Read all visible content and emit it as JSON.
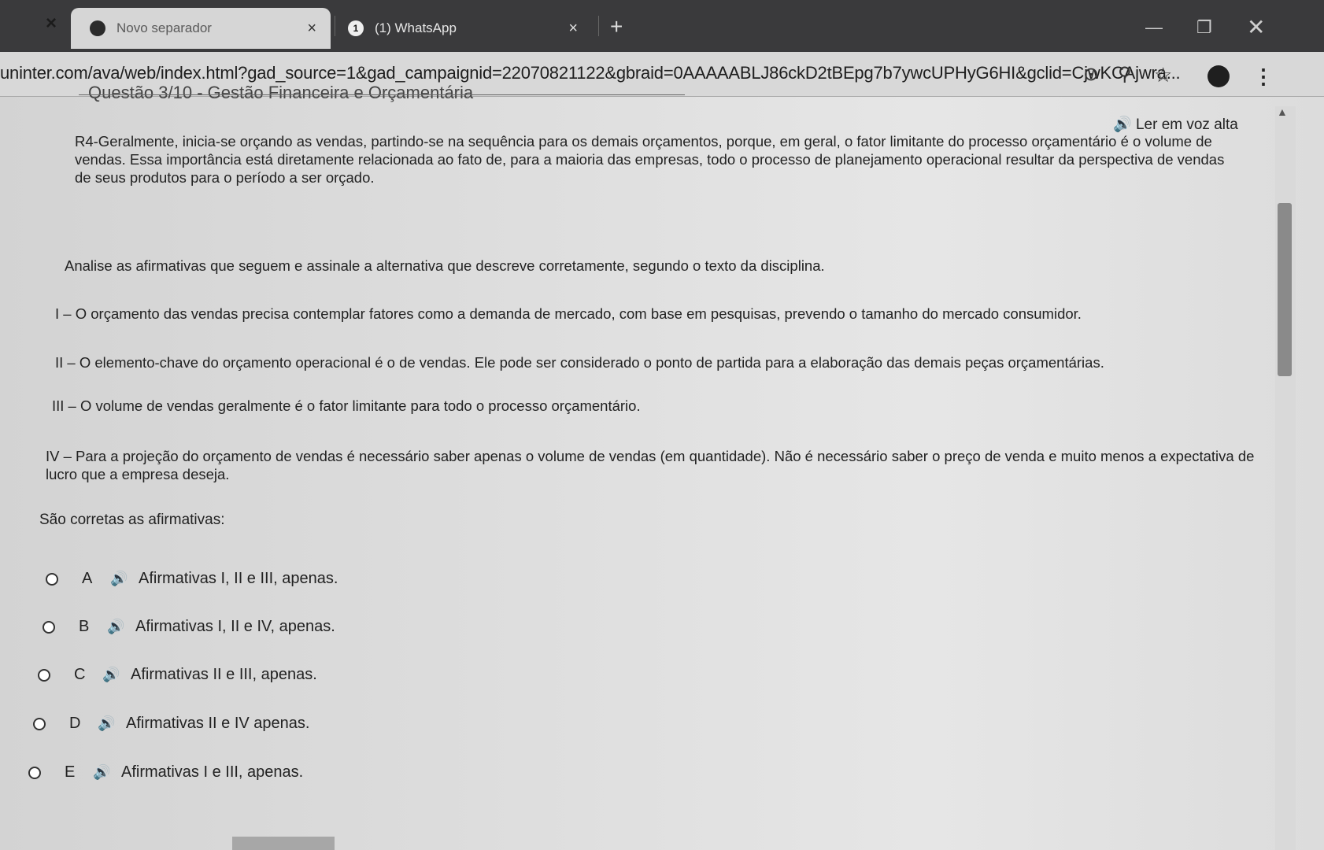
{
  "browser": {
    "tabs": [
      {
        "title": "Novo separador",
        "active": true
      },
      {
        "title": "(1) WhatsApp",
        "badge": "1",
        "active": false
      }
    ],
    "url": "uninter.com/ava/web/index.html?gad_source=1&gad_campaignid=22070821122&gbraid=0AAAAABLJ86ckD2tBEpg7b7ywcUPHyG6HI&gclid=CjwKCAjwra..."
  },
  "page": {
    "cut_heading": "Questão 3/10 - Gestão Financeira e Orçamentária",
    "tts_label": "Ler em voz alta",
    "context": "R4-Geralmente, inicia-se orçando as vendas, partindo-se na sequência para os demais orçamentos, porque, em geral, o fator limitante do processo orçamentário é o volume de vendas. Essa importância está diretamente relacionada ao fato de, para a maioria das empresas, todo o processo de planejamento operacional resultar da perspectiva de vendas de seus produtos para o período a ser orçado.",
    "prompt": "Analise as afirmativas que seguem e assinale a alternativa que descreve corretamente, segundo o texto da disciplina.",
    "statements": [
      "I – O orçamento das vendas precisa contemplar fatores como a demanda de mercado, com base em pesquisas, prevendo o tamanho do mercado consumidor.",
      "II – O elemento-chave do orçamento operacional é o de vendas. Ele pode ser considerado o ponto de partida para a elaboração das demais peças orçamentárias.",
      "III – O volume de vendas geralmente é o fator limitante para todo o processo orçamentário.",
      "IV – Para a projeção do orçamento de vendas é necessário saber apenas o volume de vendas (em quantidade). Não é necessário saber o preço de venda e muito menos a expectativa de lucro que a empresa deseja."
    ],
    "correct_label": "São corretas as afirmativas:",
    "options": [
      {
        "letter": "A",
        "text": "Afirmativas I, II e III, apenas."
      },
      {
        "letter": "B",
        "text": "Afirmativas I, II e IV, apenas."
      },
      {
        "letter": "C",
        "text": "Afirmativas II e III, apenas."
      },
      {
        "letter": "D",
        "text": "Afirmativas II e IV apenas."
      },
      {
        "letter": "E",
        "text": "Afirmativas I e III, apenas."
      }
    ]
  }
}
